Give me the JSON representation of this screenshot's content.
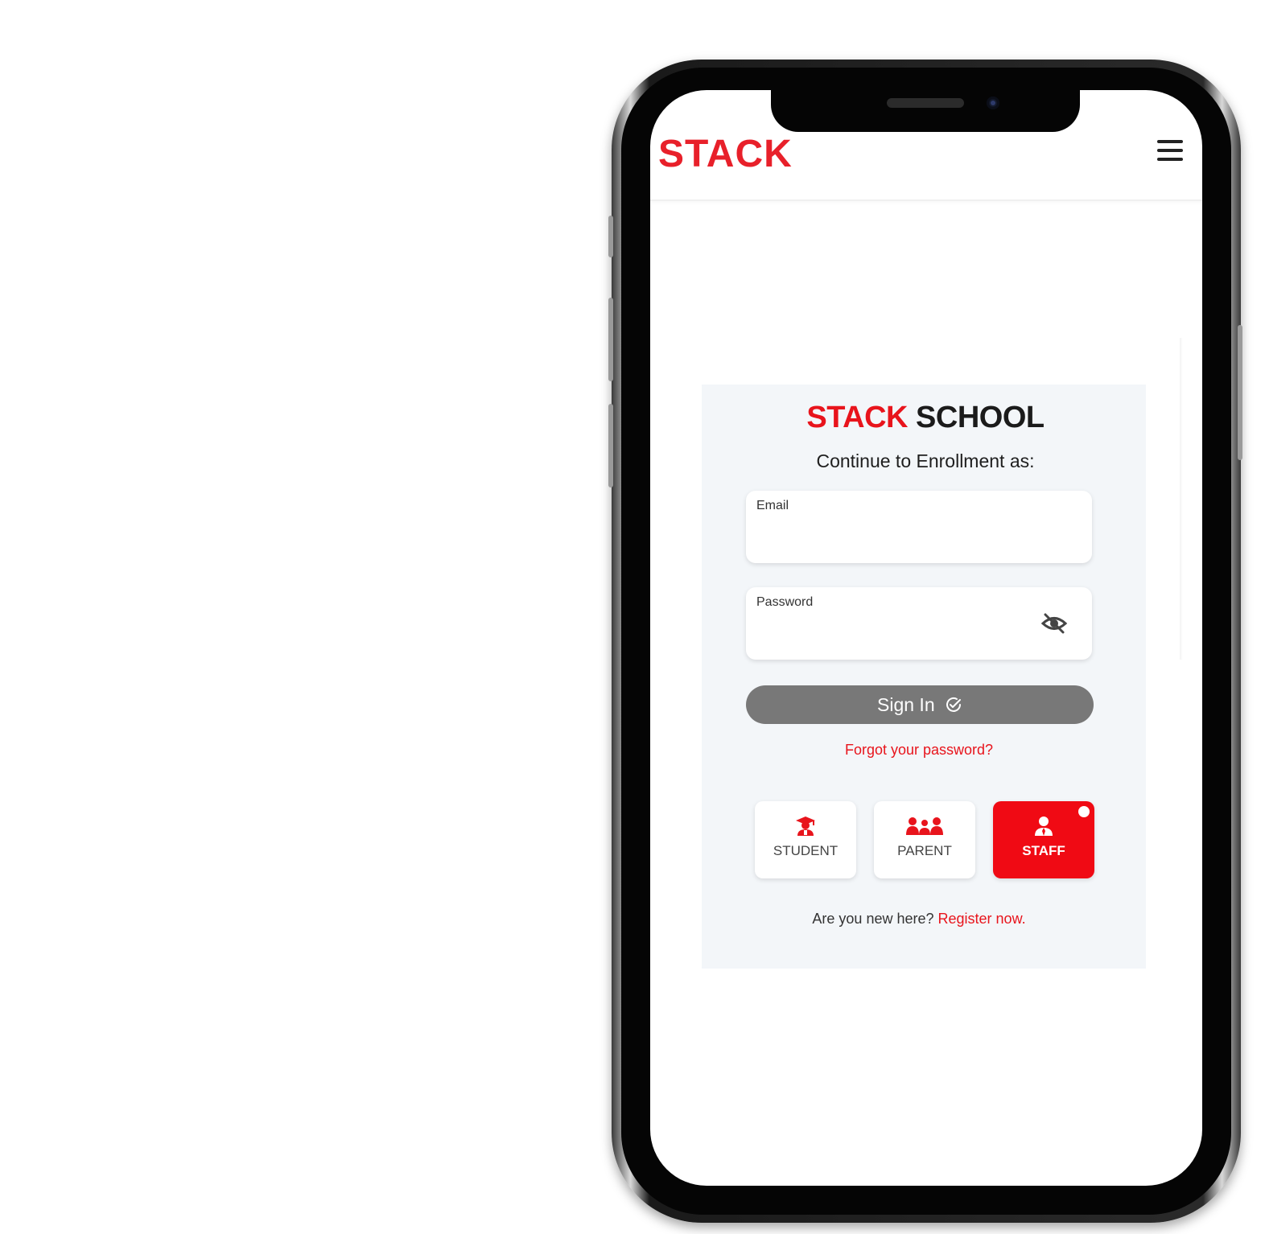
{
  "navbar": {
    "brand": "STACK",
    "menu_icon": "hamburger-menu-icon"
  },
  "login": {
    "title_red": "STACK",
    "title_dark": "SCHOOL",
    "subtitle": "Continue to Enrollment as:",
    "email": {
      "label": "Email",
      "value": ""
    },
    "password": {
      "label": "Password",
      "value": "",
      "toggle_icon": "eye-off-icon"
    },
    "signin_label": "Sign In",
    "forgot_link": "Forgot your password?",
    "roles": [
      {
        "label": "STUDENT",
        "icon": "student-icon",
        "selected": false
      },
      {
        "label": "PARENT",
        "icon": "parents-icon",
        "selected": false
      },
      {
        "label": "STAFF",
        "icon": "staff-icon",
        "selected": true
      }
    ],
    "register_prompt": "Are you new here?",
    "register_link": "Register now."
  },
  "colors": {
    "accent": "#e8141c",
    "button_gray": "#787878",
    "card_bg": "#f3f6f9"
  }
}
